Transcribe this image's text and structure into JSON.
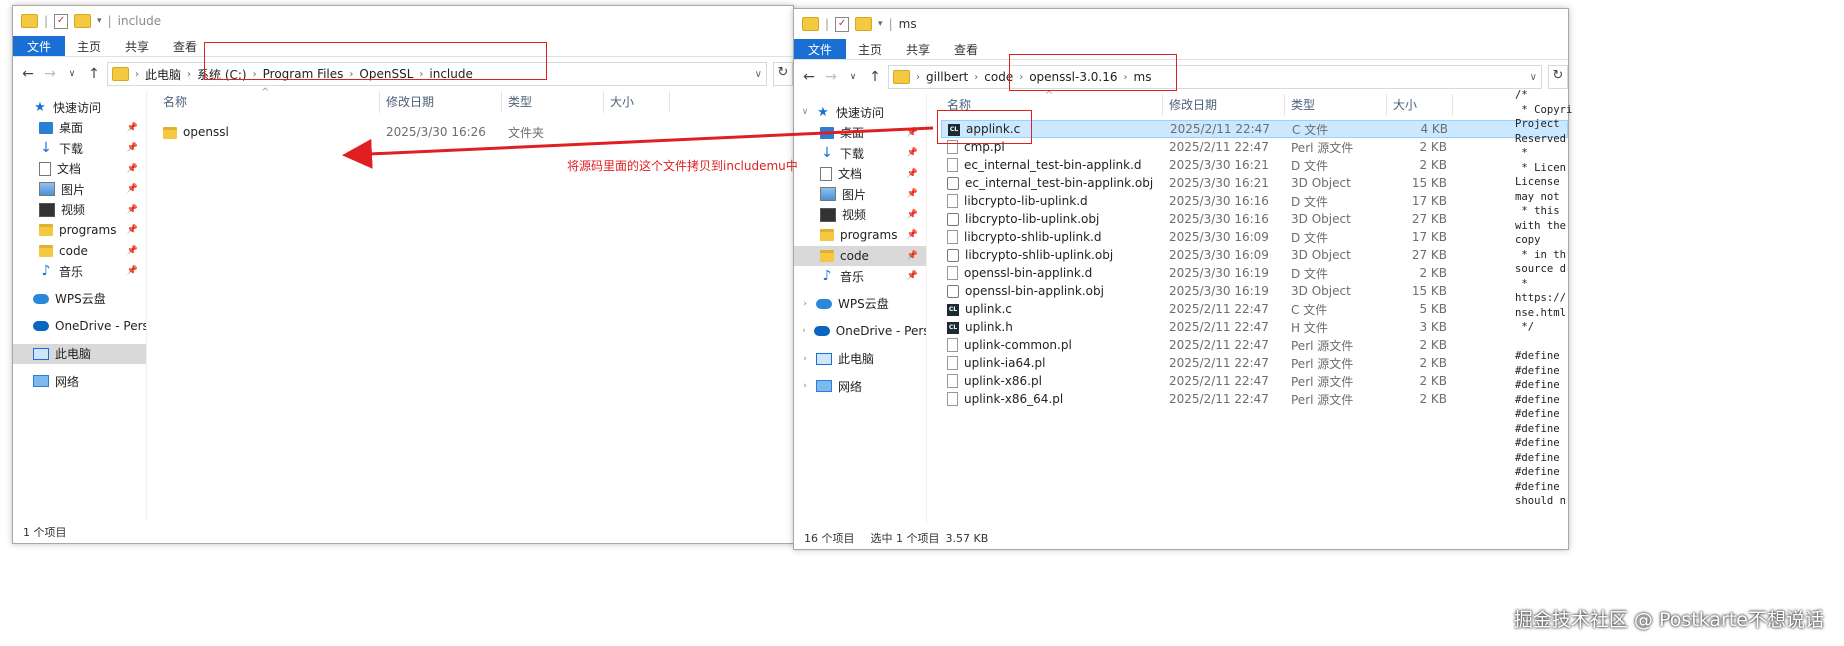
{
  "left_window": {
    "title": "include",
    "ribbon_tabs": [
      "文件",
      "主页",
      "共享",
      "查看"
    ],
    "address_path": [
      "此电脑",
      "系统 (C:)",
      "Program Files",
      "OpenSSL",
      "include"
    ],
    "nav": [
      {
        "label": "快速访问",
        "icon": "star-icon",
        "pinned": false
      },
      {
        "label": "桌面",
        "icon": "desktop-icon",
        "pinned": true
      },
      {
        "label": "下载",
        "icon": "download-icon",
        "pinned": true
      },
      {
        "label": "文档",
        "icon": "document-icon",
        "pinned": true
      },
      {
        "label": "图片",
        "icon": "picture-icon",
        "pinned": true
      },
      {
        "label": "视频",
        "icon": "video-icon",
        "pinned": true
      },
      {
        "label": "programs",
        "icon": "folder-icon",
        "pinned": true
      },
      {
        "label": "code",
        "icon": "folder-icon",
        "pinned": true
      },
      {
        "label": "音乐",
        "icon": "music-icon",
        "pinned": true
      },
      {
        "label": "WPS云盘",
        "icon": "wps-cloud-icon",
        "pinned": false
      },
      {
        "label": "OneDrive - Persona",
        "icon": "onedrive-icon",
        "pinned": false
      },
      {
        "label": "此电脑",
        "icon": "this-pc-icon",
        "pinned": false
      },
      {
        "label": "网络",
        "icon": "network-icon",
        "pinned": false
      }
    ],
    "columns": [
      "名称",
      "修改日期",
      "类型",
      "大小"
    ],
    "files": [
      {
        "name": "openssl",
        "date": "2025/3/30 16:26",
        "type": "文件夹",
        "size": ""
      }
    ],
    "status": "1 个项目"
  },
  "right_window": {
    "title": "ms",
    "ribbon_tabs": [
      "文件",
      "主页",
      "共享",
      "查看"
    ],
    "address_path": [
      "gillbert",
      "code",
      "openssl-3.0.16",
      "ms"
    ],
    "nav": [
      {
        "label": "快速访问",
        "icon": "star-icon",
        "pinned": false
      },
      {
        "label": "桌面",
        "icon": "desktop-icon",
        "pinned": true
      },
      {
        "label": "下载",
        "icon": "download-icon",
        "pinned": true
      },
      {
        "label": "文档",
        "icon": "document-icon",
        "pinned": true
      },
      {
        "label": "图片",
        "icon": "picture-icon",
        "pinned": true
      },
      {
        "label": "视频",
        "icon": "video-icon",
        "pinned": true
      },
      {
        "label": "programs",
        "icon": "folder-icon",
        "pinned": true
      },
      {
        "label": "code",
        "icon": "folder-icon",
        "pinned": true
      },
      {
        "label": "音乐",
        "icon": "music-icon",
        "pinned": true
      },
      {
        "label": "WPS云盘",
        "icon": "wps-cloud-icon",
        "pinned": false
      },
      {
        "label": "OneDrive - Persona",
        "icon": "onedrive-icon",
        "pinned": false
      },
      {
        "label": "此电脑",
        "icon": "this-pc-icon",
        "pinned": false
      },
      {
        "label": "网络",
        "icon": "network-icon",
        "pinned": false
      }
    ],
    "columns": [
      "名称",
      "修改日期",
      "类型",
      "大小"
    ],
    "files": [
      {
        "name": "applink.c",
        "date": "2025/2/11 22:47",
        "type": "C 文件",
        "size": "4 KB",
        "icon": "c-file-icon"
      },
      {
        "name": "cmp.pl",
        "date": "2025/2/11 22:47",
        "type": "Perl 源文件",
        "size": "2 KB",
        "icon": "file-icon"
      },
      {
        "name": "ec_internal_test-bin-applink.d",
        "date": "2025/3/30 16:21",
        "type": "D 文件",
        "size": "2 KB",
        "icon": "file-icon"
      },
      {
        "name": "ec_internal_test-bin-applink.obj",
        "date": "2025/3/30 16:21",
        "type": "3D Object",
        "size": "15 KB",
        "icon": "object-file-icon"
      },
      {
        "name": "libcrypto-lib-uplink.d",
        "date": "2025/3/30 16:16",
        "type": "D 文件",
        "size": "17 KB",
        "icon": "file-icon"
      },
      {
        "name": "libcrypto-lib-uplink.obj",
        "date": "2025/3/30 16:16",
        "type": "3D Object",
        "size": "27 KB",
        "icon": "object-file-icon"
      },
      {
        "name": "libcrypto-shlib-uplink.d",
        "date": "2025/3/30 16:09",
        "type": "D 文件",
        "size": "17 KB",
        "icon": "file-icon"
      },
      {
        "name": "libcrypto-shlib-uplink.obj",
        "date": "2025/3/30 16:09",
        "type": "3D Object",
        "size": "27 KB",
        "icon": "object-file-icon"
      },
      {
        "name": "openssl-bin-applink.d",
        "date": "2025/3/30 16:19",
        "type": "D 文件",
        "size": "2 KB",
        "icon": "file-icon"
      },
      {
        "name": "openssl-bin-applink.obj",
        "date": "2025/3/30 16:19",
        "type": "3D Object",
        "size": "15 KB",
        "icon": "object-file-icon"
      },
      {
        "name": "uplink.c",
        "date": "2025/2/11 22:47",
        "type": "C 文件",
        "size": "5 KB",
        "icon": "c-file-icon"
      },
      {
        "name": "uplink.h",
        "date": "2025/2/11 22:47",
        "type": "H 文件",
        "size": "3 KB",
        "icon": "h-file-icon"
      },
      {
        "name": "uplink-common.pl",
        "date": "2025/2/11 22:47",
        "type": "Perl 源文件",
        "size": "2 KB",
        "icon": "file-icon"
      },
      {
        "name": "uplink-ia64.pl",
        "date": "2025/2/11 22:47",
        "type": "Perl 源文件",
        "size": "2 KB",
        "icon": "file-icon"
      },
      {
        "name": "uplink-x86.pl",
        "date": "2025/2/11 22:47",
        "type": "Perl 源文件",
        "size": "2 KB",
        "icon": "file-icon"
      },
      {
        "name": "uplink-x86_64.pl",
        "date": "2025/2/11 22:47",
        "type": "Perl 源文件",
        "size": "2 KB",
        "icon": "file-icon"
      }
    ],
    "status_count": "16 个项目",
    "status_selected": "选中 1 个项目",
    "status_size": "3.57 KB"
  },
  "annotation": "将源码里面的这个文件拷贝到includemu中",
  "code_lines": [
    "/*",
    " * Copyri",
    "Project",
    "Reserved",
    " *",
    " * Licen",
    "License",
    "may not",
    " * this",
    "with the",
    "copy",
    " * in th",
    "source d",
    " *",
    "https://",
    "nse.html",
    " */",
    "",
    "#define",
    "#define",
    "#define",
    "#define",
    "#define",
    "#define",
    "#define",
    "#define",
    "#define",
    "#define",
    "should n"
  ],
  "watermark": "掘金技术社区 @ Postkarte不想说话",
  "colors": {
    "accent": "#1a6fd4",
    "annotation_red": "#e02020",
    "selection": "#cce8ff"
  }
}
